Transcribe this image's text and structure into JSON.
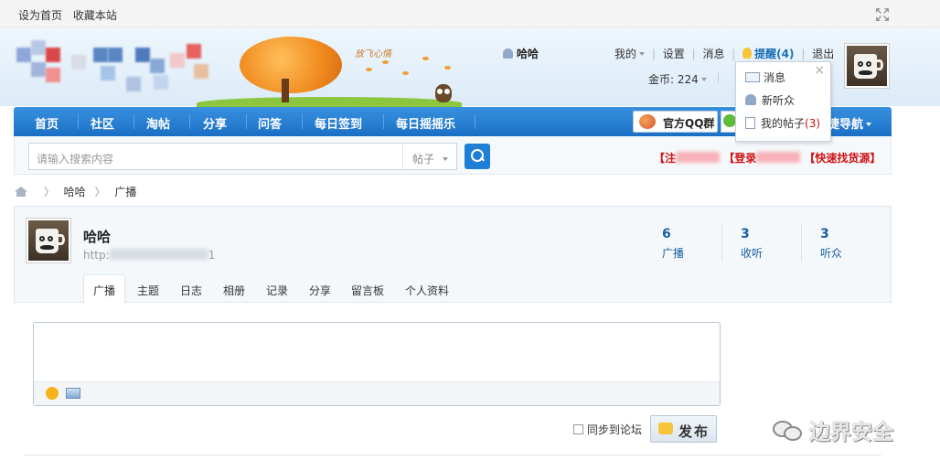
{
  "topbar": {
    "set_home": "设为首页",
    "bookmark": "收藏本站"
  },
  "banner": {
    "slogan": "放飞心情"
  },
  "user": {
    "name": "哈哈",
    "menu": {
      "mine": "我的",
      "settings": "设置",
      "messages": "消息",
      "remind": "提醒(4)",
      "logout": "退出"
    },
    "coins": "金币: 224"
  },
  "dropdown": {
    "items": [
      {
        "label": "消息"
      },
      {
        "label": "新听众"
      },
      {
        "label": "我的帖子",
        "count": "(3)"
      }
    ]
  },
  "nav": {
    "items": [
      "首页",
      "社区",
      "淘帖",
      "分享",
      "问答",
      "每日签到",
      "每日摇摇乐"
    ],
    "qq_group": "官方QQ群",
    "quick_nav": "捷导航"
  },
  "search": {
    "placeholder": "请输入搜索内容",
    "type": "帖子",
    "links": {
      "register": "【注",
      "login": "【登录",
      "find": "【快速找货源】"
    }
  },
  "breadcrumb": {
    "user": "哈哈",
    "current": "广播"
  },
  "profile": {
    "name": "哈哈",
    "url_prefix": "http:",
    "url_suffix": "1",
    "stats": [
      {
        "num": "6",
        "label": "广播"
      },
      {
        "num": "3",
        "label": "收听"
      },
      {
        "num": "3",
        "label": "听众"
      }
    ],
    "tabs": [
      "广播",
      "主题",
      "日志",
      "相册",
      "记录",
      "分享",
      "留言板",
      "个人资料"
    ]
  },
  "composer": {
    "sync_label": "同步到论坛",
    "publish_label": "发布"
  },
  "watermark": {
    "text": "边界安全"
  },
  "colors": {
    "nav_blue": "#1a6fc4",
    "link_red": "#d01010",
    "stat_blue": "#1a5fa3"
  }
}
